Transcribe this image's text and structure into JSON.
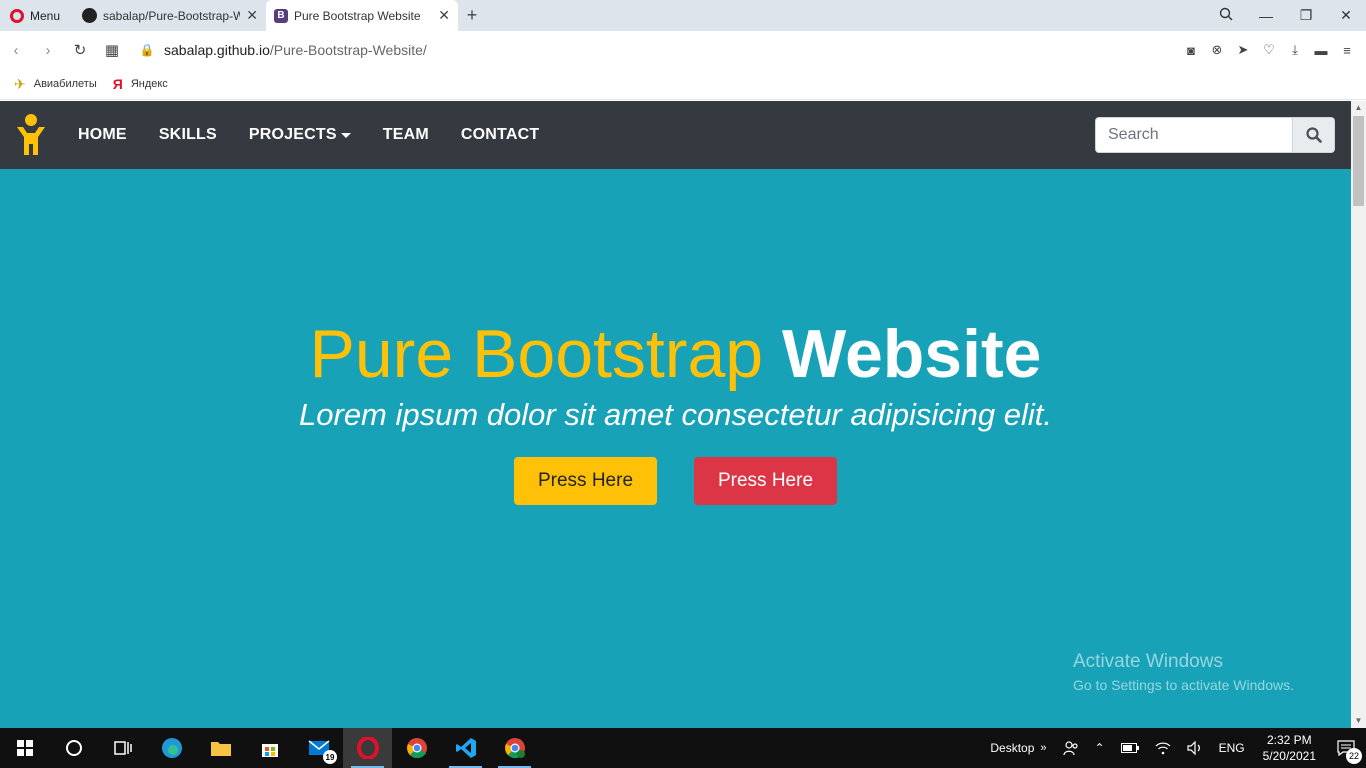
{
  "browser": {
    "menu_label": "Menu",
    "tabs": [
      {
        "title": "sabalap/Pure-Bootstrap-W",
        "icon": "github-icon"
      },
      {
        "title": "Pure Bootstrap Website",
        "icon": "bootstrap-icon"
      }
    ],
    "new_tab": "+",
    "url_host": "sabalap.github.io",
    "url_path": "/Pure-Bootstrap-Website/",
    "bookmarks": [
      {
        "label": "Авиабилеты",
        "icon": "plane-icon"
      },
      {
        "label": "Яндекс",
        "icon": "yandex-icon"
      }
    ]
  },
  "site": {
    "nav": {
      "items": [
        "HOME",
        "SKILLS",
        "PROJECTS",
        "TEAM",
        "CONTACT"
      ],
      "search_placeholder": "Search"
    },
    "hero": {
      "title_light": "Pure Bootstrap",
      "title_bold": "Website",
      "subtitle": "Lorem ipsum dolor sit amet consectetur adipisicing elit.",
      "button_primary": "Press Here",
      "button_secondary": "Press Here"
    },
    "colors": {
      "hero_bg": "#17a2b8",
      "navbar_bg": "#343a40",
      "accent_yellow": "#ffc107",
      "accent_red": "#dc3545"
    }
  },
  "watermark": {
    "line1": "Activate Windows",
    "line2": "Go to Settings to activate Windows."
  },
  "taskbar": {
    "mail_count": "19",
    "desktop_label": "Desktop",
    "lang": "ENG",
    "time": "2:32 PM",
    "date": "5/20/2021",
    "notifications": "22"
  }
}
